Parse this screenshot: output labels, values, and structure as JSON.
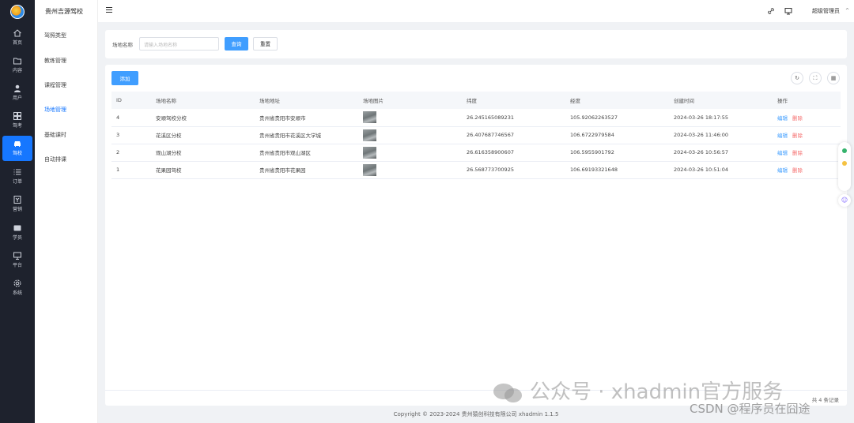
{
  "app": {
    "name": "贵州吉源驾校",
    "user": "超级管理员",
    "footer": "Copyright © 2023-2024 贵州猿创科技有限公司  xhadmin 1.1.5"
  },
  "rail": [
    {
      "label": "首页",
      "icon": "home-icon"
    },
    {
      "label": "内容",
      "icon": "folder-icon"
    },
    {
      "label": "用户",
      "icon": "user-icon"
    },
    {
      "label": "驾考",
      "icon": "grid-icon"
    },
    {
      "label": "驾校",
      "icon": "car-icon",
      "active": true
    },
    {
      "label": "订单",
      "icon": "list-icon"
    },
    {
      "label": "营销",
      "icon": "coupon-icon"
    },
    {
      "label": "学员",
      "icon": "student-icon"
    },
    {
      "label": "平台",
      "icon": "monitor-icon"
    },
    {
      "label": "系统",
      "icon": "gear-icon"
    }
  ],
  "submenu": {
    "items": [
      {
        "label": "驾照类型"
      },
      {
        "label": "教练管理"
      },
      {
        "label": "课程管理"
      },
      {
        "label": "场地管理",
        "active": true
      },
      {
        "label": "基础课时"
      },
      {
        "label": "自动排课"
      }
    ]
  },
  "search": {
    "label": "场地名称",
    "placeholder": "请输入场地名称",
    "query_button": "查询",
    "reset_button": "重置"
  },
  "table": {
    "add_button": "添加",
    "columns": [
      "ID",
      "场地名称",
      "场地地址",
      "场地图片",
      "纬度",
      "经度",
      "创建时间",
      "操作"
    ],
    "rows": [
      {
        "id": "4",
        "name": "安顺驾校分校",
        "address": "贵州省贵阳市安顺市",
        "lat": "26.245165089231",
        "lng": "105.92062263527",
        "created": "2024-03-26 18:17:55"
      },
      {
        "id": "3",
        "name": "花溪区分校",
        "address": "贵州省贵阳市花溪区大学城",
        "lat": "26.407687746567",
        "lng": "106.6722979584",
        "created": "2024-03-26 11:46:00"
      },
      {
        "id": "2",
        "name": "观山湖分校",
        "address": "贵州省贵阳市观山湖区",
        "lat": "26.616358900607",
        "lng": "106.5955901792",
        "created": "2024-03-26 10:56:57"
      },
      {
        "id": "1",
        "name": "花果园驾校",
        "address": "贵州省贵阳市花果园",
        "lat": "26.568773700925",
        "lng": "106.69193321648",
        "created": "2024-03-26 10:51:04"
      }
    ],
    "edit_label": "编辑",
    "delete_label": "删除",
    "pager_total": "共 4 条记录"
  },
  "watermark": {
    "line1": "公众号 · xhadmin官方服务",
    "line2": "CSDN @程序员在囧途"
  },
  "colors": {
    "primary": "#409eff",
    "rail_bg": "#1e222d",
    "active": "#1677ff",
    "danger": "#f56c6c"
  }
}
